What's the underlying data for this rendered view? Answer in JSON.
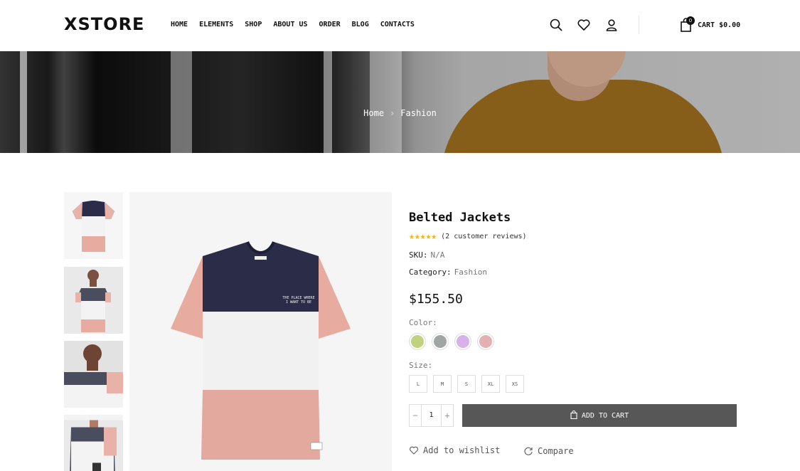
{
  "header": {
    "logo": "XSTORE",
    "nav": [
      "HOME",
      "ELEMENTS",
      "SHOP",
      "ABOUT US",
      "ORDER",
      "BLOG",
      "CONTACTS"
    ],
    "icons": [
      "search-icon",
      "heart-icon",
      "user-icon",
      "shopping-bag-icon"
    ],
    "cart_count": "0",
    "cart_label": "CART $0.00"
  },
  "breadcrumb": {
    "home": "Home",
    "separator": ">",
    "current": "Fashion"
  },
  "gallery": {
    "thumbnail_count": 4,
    "main_alt": "t-shirt"
  },
  "product": {
    "title": "Belted Jackets",
    "stars": "★★★★★",
    "reviews": "(2 customer reviews)",
    "sku_label": "SKU:",
    "sku_value": "N/A",
    "category_label": "Category:",
    "category_value": "Fashion",
    "price": "$155.50",
    "color_label": "Color:",
    "colors": [
      "#c1d27e",
      "#a0a4a3",
      "#d8b0ea",
      "#e3b1b1"
    ],
    "size_label": "Size:",
    "sizes": [
      "L",
      "M",
      "S",
      "XL",
      "XS"
    ],
    "quantity": "1",
    "qty_minus": "−",
    "qty_plus": "+",
    "add_to_cart": "ADD TO CART",
    "wishlist": "Add to wishlist",
    "compare": "Compare"
  },
  "colors": {
    "accent_star": "#f3b414",
    "button_bg": "#575757"
  }
}
